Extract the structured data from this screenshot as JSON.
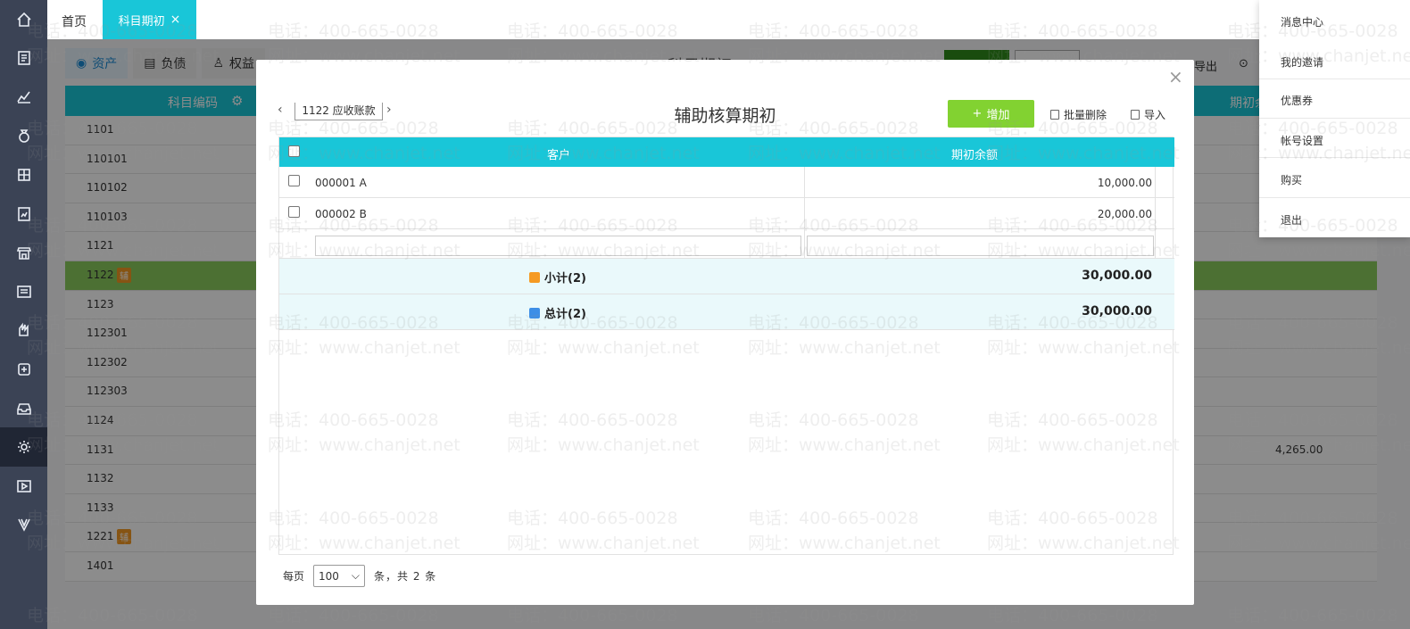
{
  "tabs": {
    "home": "首页",
    "active": "科目期初",
    "close": "×"
  },
  "left_rail": [
    "home-icon",
    "voucher-icon",
    "chart-icon",
    "money-bag-icon",
    "ledger-icon",
    "report-icon",
    "shop-icon",
    "invoice-icon",
    "salary-icon",
    "tax-icon",
    "inbox-icon",
    "settings-icon",
    "video-icon",
    "vip-icon"
  ],
  "background": {
    "subtabs": [
      "资产",
      "负债",
      "权益"
    ],
    "title": "科目期初",
    "export": "导出",
    "head_code": "科目编码",
    "head_balance": "期初余",
    "rows": [
      {
        "code": "1101",
        "tag": "",
        "amount": ""
      },
      {
        "code": "110101",
        "tag": "",
        "amount": ""
      },
      {
        "code": "110102",
        "tag": "",
        "amount": ""
      },
      {
        "code": "110103",
        "tag": "",
        "amount": ""
      },
      {
        "code": "1121",
        "tag": "",
        "amount": ""
      },
      {
        "code": "1122",
        "tag": "辅",
        "amount": ""
      },
      {
        "code": "1123",
        "tag": "",
        "amount": ""
      },
      {
        "code": "112301",
        "tag": "",
        "amount": ""
      },
      {
        "code": "112302",
        "tag": "",
        "amount": ""
      },
      {
        "code": "112303",
        "tag": "",
        "amount": ""
      },
      {
        "code": "1124",
        "tag": "",
        "amount": ""
      },
      {
        "code": "1131",
        "tag": "",
        "amount": "4,265.00"
      },
      {
        "code": "1132",
        "tag": "",
        "amount": ""
      },
      {
        "code": "1133",
        "tag": "",
        "amount": ""
      },
      {
        "code": "1221",
        "tag": "辅",
        "amount": ""
      },
      {
        "code": "1401",
        "tag": "",
        "amount": ""
      }
    ]
  },
  "modal": {
    "close": "×",
    "prev": "‹",
    "next": "›",
    "account": "1122  应收账款",
    "title": "辅助核算期初",
    "add": "增加",
    "add_icon": "+",
    "batch_delete": "批量删除",
    "import": "导入",
    "col_customer": "客户",
    "col_balance": "期初余额",
    "rows": [
      {
        "name": "000001 A",
        "balance": "10,000.00"
      },
      {
        "name": "000002 B",
        "balance": "20,000.00"
      }
    ],
    "subtotal_label": "小计(2)",
    "subtotal_value": "30,000.00",
    "total_label": "总计(2)",
    "total_value": "30,000.00",
    "per_page_label": "每页",
    "per_page_value": "100",
    "count_text": "条，共 2 条"
  },
  "user_menu": [
    "消息中心",
    "我的邀请",
    "优惠券",
    "帐号设置",
    "购买",
    "退出"
  ],
  "watermark": {
    "phone": "电话：400-665-0028",
    "site": "网址：www.chanjet.net"
  },
  "colors": {
    "accent": "#19c6d8",
    "add_button": "#82d231",
    "highlight_row": "#8acd5d",
    "tag": "#f59a23",
    "rail": "#3b4355"
  }
}
